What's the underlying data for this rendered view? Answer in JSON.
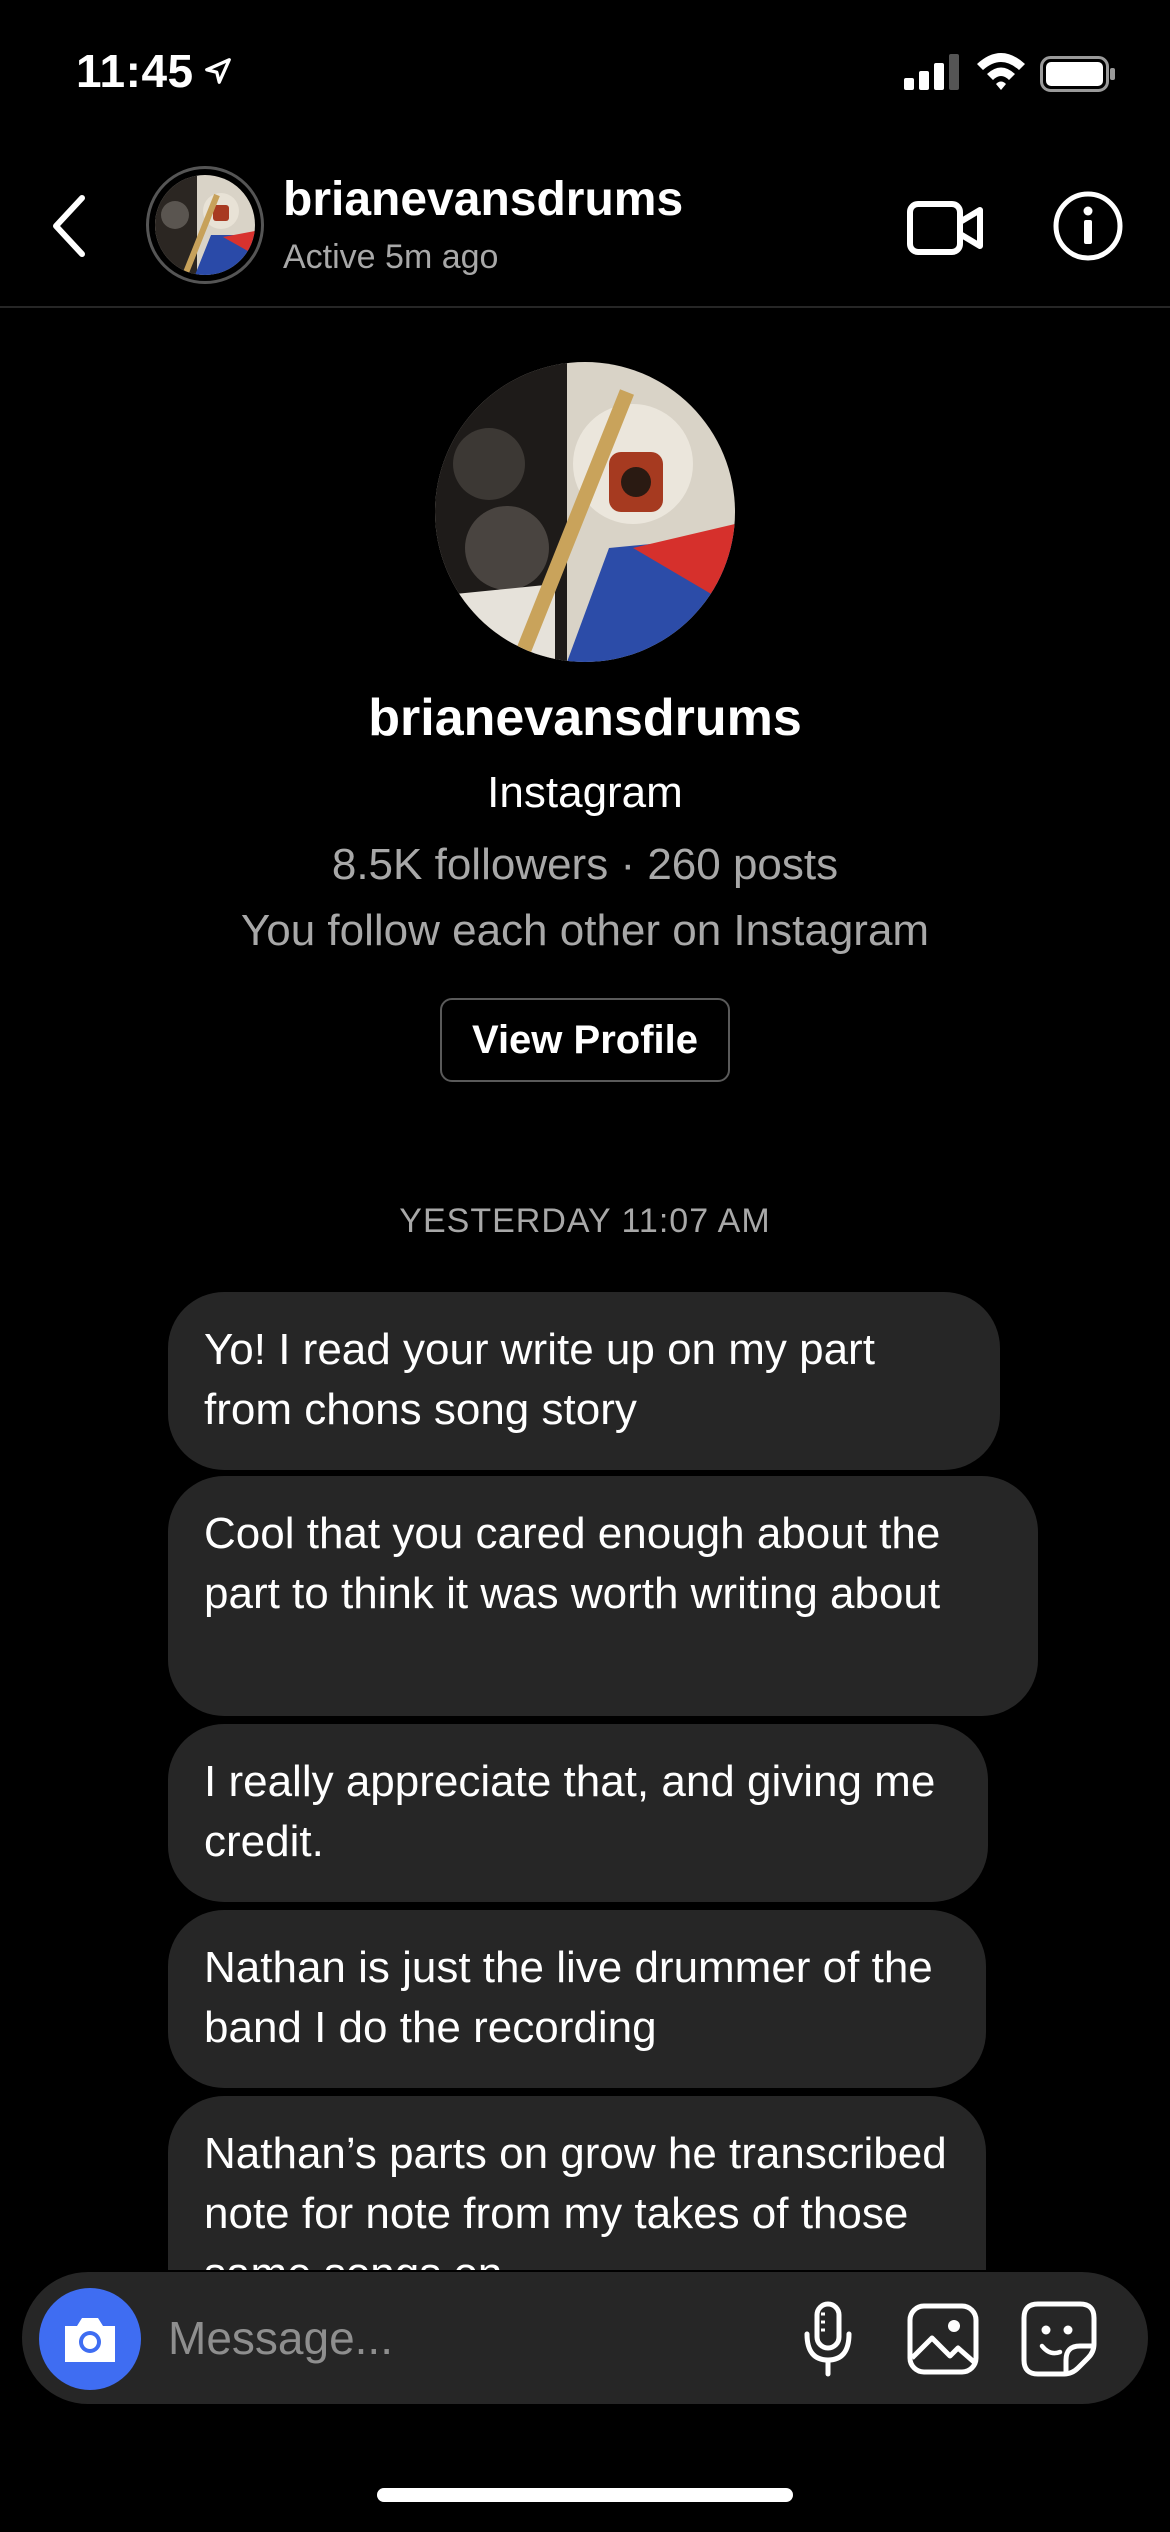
{
  "status_bar": {
    "time": "11:45",
    "icons": [
      "location-arrow-icon",
      "cellular-signal-icon",
      "wifi-icon",
      "battery-icon"
    ]
  },
  "header": {
    "back_icon": "chevron-left-icon",
    "username": "brianevansdrums",
    "activity": "Active 5m ago",
    "video_icon": "video-camera-icon",
    "info_icon": "info-icon"
  },
  "profile": {
    "username": "brianevansdrums",
    "platform": "Instagram",
    "stats": "8.5K followers · 260 posts",
    "mutual": "You follow each other on Instagram",
    "view_profile_label": "View Profile"
  },
  "conversation": {
    "timestamp": "YESTERDAY 11:07 AM",
    "messages": [
      {
        "text": "Yo! I read your write up on my part from chons song story"
      },
      {
        "text": "Cool that you cared enough about the part to think it was worth writing about"
      },
      {
        "text": "I really appreciate that, and giving me credit."
      },
      {
        "text": "Nathan is just the live drummer of the band I do the recording"
      },
      {
        "text": "Nathan’s parts on grow he transcribed note for note from my takes of those same songs on"
      }
    ]
  },
  "composer": {
    "placeholder": "Message...",
    "camera_icon": "camera-icon",
    "mic_icon": "microphone-icon",
    "gallery_icon": "image-gallery-icon",
    "sticker_icon": "sticker-icon"
  },
  "colors": {
    "background": "#000000",
    "bubble": "#262626",
    "secondary_text": "#a8a8a8",
    "accent_blue": "#3f6df2"
  }
}
